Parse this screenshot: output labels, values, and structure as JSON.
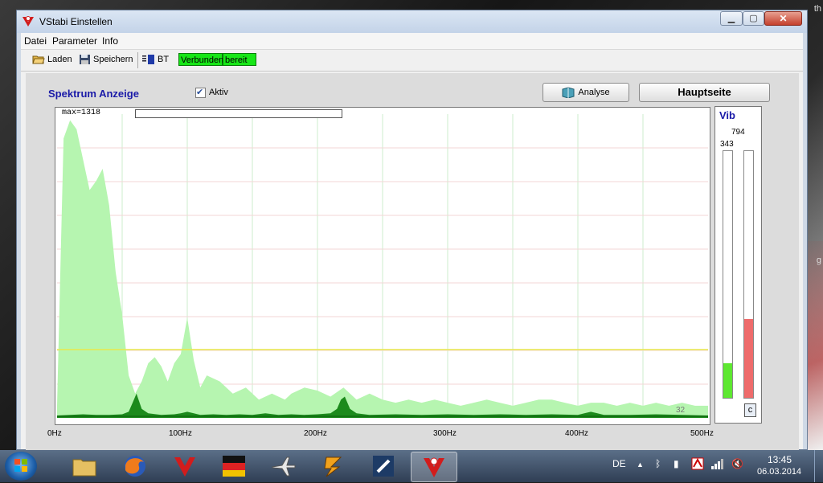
{
  "window": {
    "title": "VStabi Einstellen"
  },
  "menu": [
    "Datei",
    "Parameter",
    "Info"
  ],
  "toolbar": {
    "load": "Laden",
    "save": "Speichern",
    "bt": "BT",
    "status_connected": "Verbunden",
    "status_ready": "bereit"
  },
  "panel": {
    "title": "Spektrum Anzeige",
    "aktiv_label": "Aktiv",
    "aktiv_checked": true,
    "analyse_label": "Analyse",
    "hauptseite_label": "Hauptseite"
  },
  "chart_data": {
    "type": "area",
    "max_label": "max=1318",
    "corner_value": "32",
    "xlim": [
      0,
      500
    ],
    "x_ticks": [
      "0Hz",
      "100Hz",
      "200Hz",
      "300Hz",
      "400Hz",
      "500Hz"
    ],
    "threshold_frac": 0.225,
    "series": [
      {
        "color": "#b6f5b0",
        "x": [
          0,
          5,
          10,
          15,
          20,
          25,
          30,
          35,
          40,
          45,
          50,
          55,
          60,
          65,
          70,
          75,
          80,
          85,
          90,
          95,
          100,
          105,
          110,
          115,
          120,
          125,
          130,
          135,
          140,
          145,
          150,
          155,
          160,
          165,
          170,
          175,
          180,
          185,
          190,
          200,
          210,
          220,
          230,
          240,
          250,
          260,
          270,
          280,
          290,
          300,
          310,
          320,
          330,
          340,
          350,
          360,
          370,
          380,
          390,
          400,
          410,
          420,
          430,
          440,
          450,
          460,
          470,
          480,
          490,
          500
        ],
        "y": [
          0.04,
          0.92,
          0.98,
          0.95,
          0.85,
          0.75,
          0.78,
          0.82,
          0.7,
          0.48,
          0.34,
          0.14,
          0.08,
          0.12,
          0.18,
          0.2,
          0.17,
          0.12,
          0.18,
          0.21,
          0.33,
          0.19,
          0.1,
          0.14,
          0.13,
          0.12,
          0.1,
          0.08,
          0.09,
          0.1,
          0.08,
          0.06,
          0.07,
          0.08,
          0.07,
          0.06,
          0.08,
          0.09,
          0.1,
          0.09,
          0.07,
          0.1,
          0.06,
          0.08,
          0.06,
          0.05,
          0.06,
          0.05,
          0.06,
          0.05,
          0.04,
          0.05,
          0.06,
          0.05,
          0.04,
          0.05,
          0.06,
          0.06,
          0.05,
          0.04,
          0.05,
          0.05,
          0.04,
          0.05,
          0.04,
          0.05,
          0.04,
          0.05,
          0.04,
          0.04
        ]
      },
      {
        "color": "#1c8a1c",
        "x": [
          0,
          10,
          20,
          30,
          40,
          50,
          55,
          58,
          61,
          65,
          70,
          80,
          90,
          95,
          100,
          105,
          110,
          120,
          130,
          140,
          150,
          160,
          170,
          180,
          190,
          200,
          210,
          215,
          218,
          221,
          225,
          230,
          240,
          260,
          280,
          300,
          320,
          340,
          360,
          380,
          400,
          405,
          410,
          415,
          420,
          440,
          460,
          480,
          500
        ],
        "y": [
          0.008,
          0.01,
          0.012,
          0.01,
          0.01,
          0.012,
          0.02,
          0.05,
          0.08,
          0.03,
          0.015,
          0.01,
          0.012,
          0.015,
          0.02,
          0.015,
          0.01,
          0.012,
          0.01,
          0.012,
          0.01,
          0.015,
          0.01,
          0.012,
          0.01,
          0.012,
          0.015,
          0.03,
          0.06,
          0.07,
          0.03,
          0.015,
          0.01,
          0.012,
          0.01,
          0.012,
          0.01,
          0.012,
          0.01,
          0.012,
          0.01,
          0.015,
          0.02,
          0.015,
          0.01,
          0.01,
          0.012,
          0.01,
          0.008
        ]
      }
    ]
  },
  "vib": {
    "title": "Vib",
    "value_right": "794",
    "value_left": "343",
    "left_fill_frac": 0.14,
    "right_fill_frac": 0.32,
    "left_color": "#5ee831",
    "right_color": "#ee6b6b",
    "reset_label": "c"
  },
  "taskbar": {
    "language": "DE",
    "time": "13:45",
    "date": "06.03.2014"
  }
}
